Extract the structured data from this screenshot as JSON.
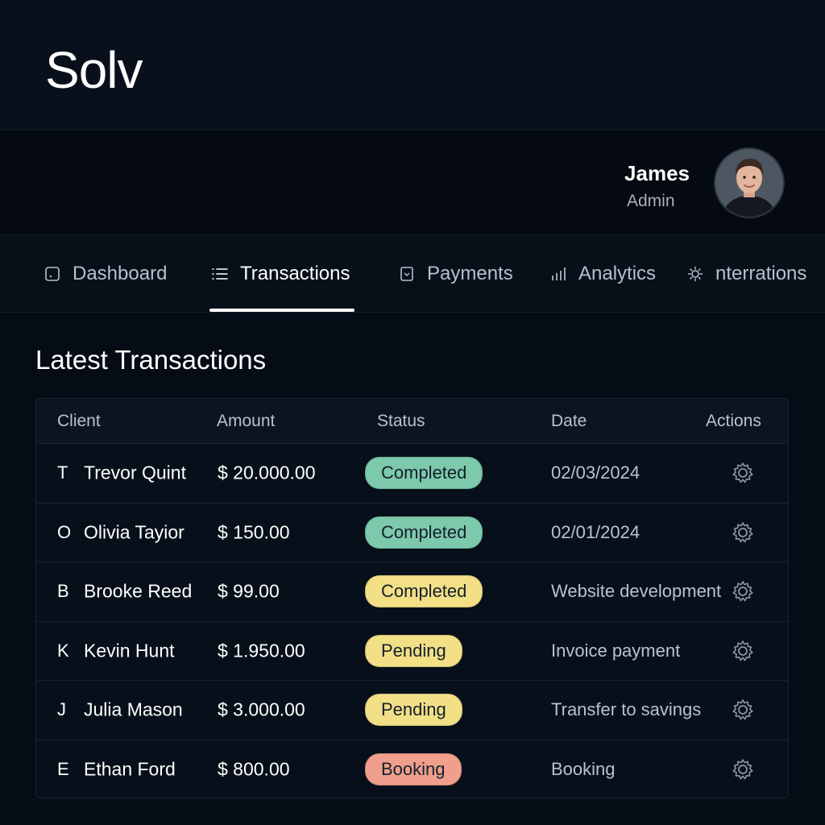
{
  "brand": {
    "name": "Solv"
  },
  "user": {
    "name": "James",
    "role": "Admin"
  },
  "tabs": [
    {
      "label": "Dashboard",
      "icon": "square-icon",
      "active": false
    },
    {
      "label": "Transactions",
      "icon": "list-icon",
      "active": true
    },
    {
      "label": "Payments",
      "icon": "card-icon",
      "active": false
    },
    {
      "label": "Analytics",
      "icon": "bar-chart-icon",
      "active": false
    },
    {
      "label": "nterrations",
      "icon": "gear-icon",
      "active": false
    }
  ],
  "section": {
    "title": "Latest Transactions"
  },
  "table": {
    "headers": {
      "client": "Client",
      "amount": "Amount",
      "status": "Status",
      "date": "Date",
      "actions": "Actions"
    },
    "rows": [
      {
        "initial": "T",
        "client": "Trevor Quint",
        "amount": "$ 20.000.00",
        "status": "Completed",
        "status_color": "#7cc9ab",
        "date": "02/03/2024"
      },
      {
        "initial": "O",
        "client": "Olivia Tayior",
        "amount": "$ 150.00",
        "status": "Completed",
        "status_color": "#7cc9ab",
        "date": "02/01/2024"
      },
      {
        "initial": "B",
        "client": "Brooke Reed",
        "amount": "$ 99.00",
        "status": "Completed",
        "status_color": "#f2df86",
        "date": "Website development"
      },
      {
        "initial": "K",
        "client": "Kevin Hunt",
        "amount": "$ 1.950.00",
        "status": "Pending",
        "status_color": "#f2df86",
        "date": "Invoice payment"
      },
      {
        "initial": "J",
        "client": "Julia Mason",
        "amount": "$ 3.000.00",
        "status": "Pending",
        "status_color": "#f2df86",
        "date": "Transfer to savings"
      },
      {
        "initial": "E",
        "client": "Ethan Ford",
        "amount": "$ 800.00",
        "status": "Booking",
        "status_color": "#ef9f8c",
        "date": "Booking"
      }
    ]
  }
}
